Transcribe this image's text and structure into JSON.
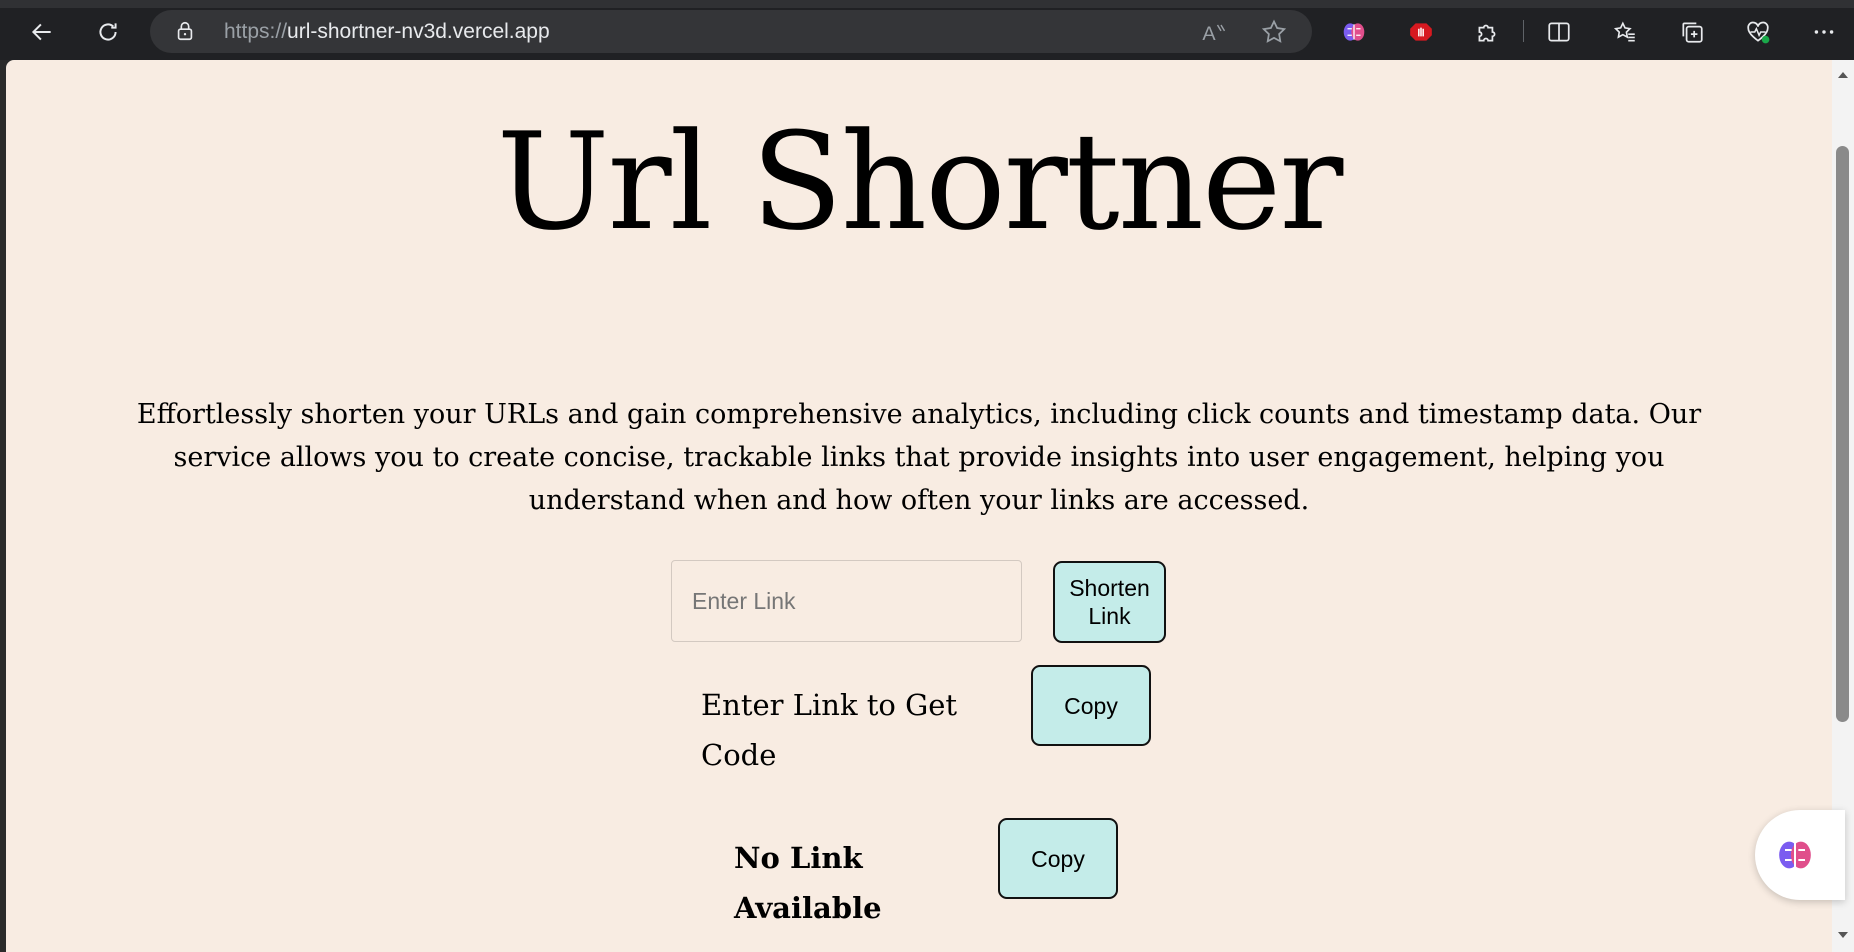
{
  "browser": {
    "url_scheme": "https://",
    "url_host": "url-shortner-nv3d.vercel.app"
  },
  "page": {
    "title": "Url Shortner",
    "description": "Effortlessly shorten your URLs and gain comprehensive analytics, including click counts and timestamp data. Our service allows you to create concise, trackable links that provide insights into user engagement, helping you understand when and how often your links are accessed.",
    "input_placeholder": "Enter Link",
    "input_value": "",
    "shorten_button": "Shorten Link",
    "code_label": "Enter Link to Get Code",
    "copy_button_1": "Copy",
    "link_label": "No Link Available",
    "copy_button_2": "Copy"
  },
  "colors": {
    "page_bg": "#f8ece2",
    "button_bg": "#c4ece9",
    "chrome_bg": "#202124"
  }
}
